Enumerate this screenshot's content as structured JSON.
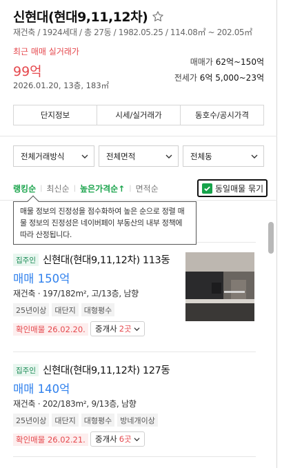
{
  "header": {
    "title": "신현대(현대9,11,12차)",
    "subinfo": "재건축 / 1924세대 / 총 27동 / 1982.05.25 / 114.08㎡ ~ 202.05㎡"
  },
  "price_summary": {
    "recent_label": "최근 매매 실거래가",
    "recent_value": "99억",
    "recent_meta": "2026.01.20, 13층, 183㎡",
    "sale_label": "매매가",
    "sale_range": "62억~150억",
    "jeonse_label": "전세가",
    "jeonse_range": "6억 5,000~23억"
  },
  "tabs": [
    {
      "label": "단지정보"
    },
    {
      "label": "시세/실거래가"
    },
    {
      "label": "동호수/공시가격"
    }
  ],
  "filters": [
    {
      "label": "전체거래방식"
    },
    {
      "label": "전체면적"
    },
    {
      "label": "전체동"
    }
  ],
  "sort": [
    {
      "label": "랭킹순",
      "active": true
    },
    {
      "label": "최신순",
      "active": false
    },
    {
      "label": "높은가격순↑",
      "active": true
    },
    {
      "label": "면적순",
      "active": false
    }
  ],
  "dup_toggle": {
    "label": "동일매물 묶기",
    "checked": true
  },
  "tooltip": {
    "text": "매물 정보의 진정성을 점수화하여 높은 순으로 정렬 매물 정보의 진정성은 네이버페이 부동산의 내부 정책에 따라 산정됩니다."
  },
  "listings": [
    {
      "badge": "집주인",
      "title": "신현대(현대9,11,12차) 113동",
      "price": "매매 150억",
      "spec": "재건축 · 197/182m², 고/13층, 남향",
      "tags": [
        "25년이상",
        "대단지",
        "대형평수"
      ],
      "confirm": "확인매물 26.02.20.",
      "broker_label": "중개사",
      "broker_count": "2곳",
      "has_thumb": true
    },
    {
      "badge": "집주인",
      "title": "신현대(현대9,11,12차) 127동",
      "price": "매매 140억",
      "spec": "재건축 · 202/183m², 9/13층, 남향",
      "tags": [
        "25년이상",
        "대단지",
        "대형평수",
        "방네개이상"
      ],
      "confirm": "확인매물 26.02.21.",
      "broker_label": "중개사",
      "broker_count": "6곳",
      "has_thumb": false
    }
  ],
  "colors": {
    "accent_green": "#16a34a",
    "price_red": "#e5484d",
    "price_blue": "#2f80ed"
  }
}
